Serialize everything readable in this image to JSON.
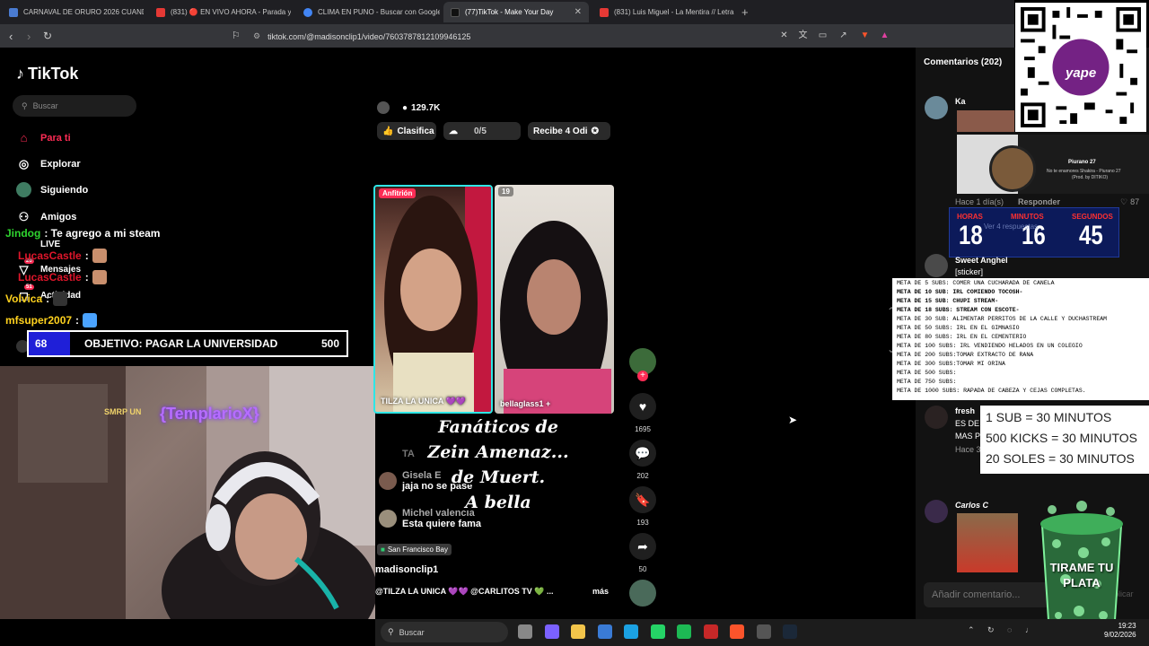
{
  "browser": {
    "tabs": [
      {
        "title": "CARNAVAL DE ORURO 2026 CUANDO",
        "color": "#4a7bd1"
      },
      {
        "title": "(831) 🔴 EN VIVO AHORA - Parada y",
        "color": "#e53935"
      },
      {
        "title": "CLIMA EN PUNO - Buscar con Google",
        "color": "#4285f4"
      },
      {
        "title": "(77)TikTok - Make Your Day",
        "color": "#111111"
      },
      {
        "title": "(831) Luis Miguel - La Mentira // Letra",
        "color": "#e53935"
      }
    ],
    "url": "tiktok.com/@madisonclip1/video/7603787812109946125"
  },
  "tiktok": {
    "logo": "TikTok",
    "search_placeholder": "Buscar",
    "nav": [
      "Para ti",
      "Explorar",
      "Siguiendo",
      "Amigos",
      "LIVE",
      "Mensajes",
      "Actividad"
    ],
    "badges": {
      "mensajes": "26",
      "actividad": "51"
    }
  },
  "stream": {
    "chat": [
      {
        "user": "Jindog",
        "msg": ": Te agrego a mi steam",
        "color": "#2fd52f"
      },
      {
        "user": "LucasCastle",
        "msg": ":",
        "color": "#e0162b"
      },
      {
        "user": "LucasCastle",
        "msg": ":",
        "color": "#e0162b"
      },
      {
        "user": "Volvica",
        "msg": ":",
        "color": "#ffd21e"
      },
      {
        "user": "mfsuper2007",
        "msg": ":",
        "color": "#ffd21e"
      }
    ],
    "goal": {
      "current": "68",
      "label": "OBJETIVO: PAGAR LA UNIVERSIDAD",
      "target": "500"
    },
    "sub_alert": "SMRP UN",
    "sub_name": "{TemplarioX}"
  },
  "video": {
    "viewers": "129.7K",
    "pills": [
      "Clasifica",
      "0/5",
      "Recibe 4 Odi"
    ],
    "host_tag": "Anfitrión",
    "guest_count": "19",
    "host_name": "TILZA LA UNICA 💜💜",
    "guest_name": "bellaglass1 +",
    "caption": [
      "Fanáticos de",
      "Zein Amenaz...",
      "de Muert.",
      "A bella"
    ],
    "comments": [
      {
        "user": "TA",
        "text": ""
      },
      {
        "user": "Gisela E",
        "text": "jaja no se pase"
      },
      {
        "user": "Michel valencia",
        "text": "Esta quiere fama"
      }
    ],
    "location": "San Francisco Bay",
    "author": "madisonclip1",
    "desc": "@TILZA LA UNICA 💜💜 @CARLITOS TV 💚 ...",
    "more": "más",
    "counts": {
      "likes": "1695",
      "comments": "202",
      "saves": "193",
      "shares": "50"
    }
  },
  "comments_panel": {
    "title": "Comentarios (202)",
    "items": [
      {
        "user": "Ka",
        "time": "Hace 1 día(s)",
        "reply": "Responder",
        "likes": "87",
        "more": "Ver 4 respuestas"
      },
      {
        "user": "Sweet Anghel",
        "text": "[sticker]"
      },
      {
        "user": "fresh",
        "text": "ES DE",
        "text2": "MAS P",
        "time": "Hace 3"
      },
      {
        "user": "Carlos C"
      }
    ],
    "add_placeholder": "Añadir comentario...",
    "music": {
      "title": "Piurano 27",
      "subtitle": "No te enamores Shakira - Piurano 27",
      "credit": "(Prod. by DITIKO)"
    }
  },
  "overlays": {
    "qr_label": "yape",
    "scores": [
      {
        "label": "HORAS",
        "value": "18"
      },
      {
        "label": "MINUTOS",
        "value": "16"
      },
      {
        "label": "SEGUNDOS",
        "value": "45"
      }
    ],
    "metas": [
      {
        "t": "META DE 5 SUBS: COMER UNA CUCHARADA DE CANELA",
        "b": false
      },
      {
        "t": "META DE 10 SUB: IRL COMIENDO TOCOSH-",
        "b": true
      },
      {
        "t": "META DE 15 SUB: CHUPI STREAM-",
        "b": true
      },
      {
        "t": "META DE 18 SUBS: STREAM CON ESCOTE-",
        "b": true
      },
      {
        "t": "META DE 30 SUB:  ALIMENTAR PERRITOS DE LA CALLE Y DUCHASTREAM",
        "b": false
      },
      {
        "t": "META DE 50 SUBS: IRL EN EL GIMNASIO",
        "b": false
      },
      {
        "t": "META DE 80 SUBS: IRL EN EL CEMENTERIO",
        "b": false
      },
      {
        "t": "META DE 100 SUBS: IRL VENDIENDO HELADOS EN UN COLEGIO",
        "b": false
      },
      {
        "t": "META DE 200 SUBS:TOMAR EXTRACTO DE RANA",
        "b": false
      },
      {
        "t": "META DE 300 SUBS:TOMAR MI ORINA",
        "b": false
      },
      {
        "t": "META DE 500 SUBS:",
        "b": false
      },
      {
        "t": "META DE 750 SUBS:",
        "b": false
      },
      {
        "t": "META DE 1000 SUBS: RAPADA DE CABEZA Y CEJAS COMPLETAS.",
        "b": false
      }
    ],
    "rates": [
      "1 SUB = 30 MINUTOS",
      "500 KICKS = 30 MINUTOS",
      "20 SOLES = 30 MINUTOS"
    ],
    "cup_text": "TIRAME TU PLATA"
  },
  "taskbar": {
    "search": "Buscar",
    "time": "19:23",
    "date": "9/02/2026",
    "icons": [
      {
        "name": "task-view-icon",
        "color": "#888888"
      },
      {
        "name": "copilot-icon",
        "color": "#7b61ff"
      },
      {
        "name": "file-explorer-icon",
        "color": "#f2c44a"
      },
      {
        "name": "store-icon",
        "color": "#3a7bd5"
      },
      {
        "name": "edge-icon",
        "color": "#1ba1e2"
      },
      {
        "name": "whatsapp-icon",
        "color": "#25d366"
      },
      {
        "name": "spotify-icon",
        "color": "#1db954"
      },
      {
        "name": "app-icon",
        "color": "#c62828"
      },
      {
        "name": "brave-icon",
        "color": "#fb542b"
      },
      {
        "name": "obs-icon",
        "color": "#555555"
      },
      {
        "name": "steam-icon",
        "color": "#1b2838"
      }
    ]
  }
}
